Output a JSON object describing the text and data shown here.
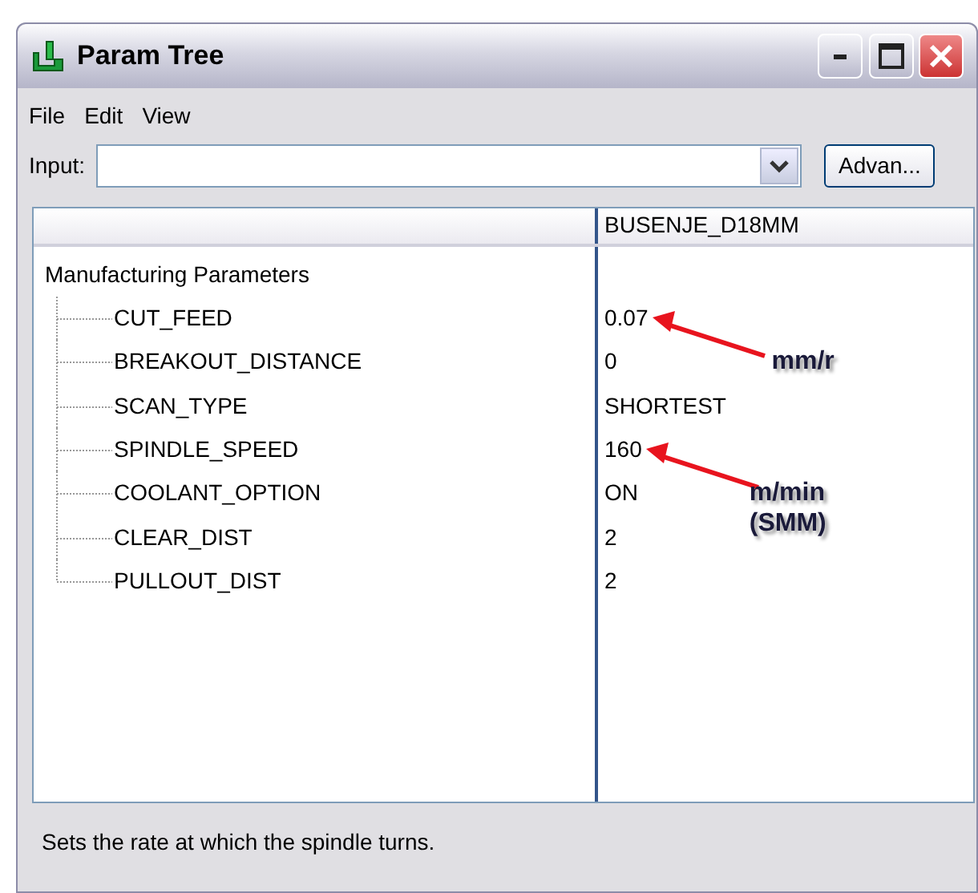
{
  "window": {
    "title": "Param Tree"
  },
  "menu": [
    "File",
    "Edit",
    "View"
  ],
  "input": {
    "label": "Input:"
  },
  "advanced_button": "Advan...",
  "tree": {
    "columns": [
      "BUSENJE_D18MM"
    ],
    "root": {
      "label": "Manufacturing Parameters",
      "children": [
        {
          "label": "CUT_FEED",
          "value": "0.07",
          "annotation": {
            "lines": [
              "mm/r"
            ]
          }
        },
        {
          "label": "BREAKOUT_DISTANCE",
          "value": "0"
        },
        {
          "label": "SCAN_TYPE",
          "value": "SHORTEST"
        },
        {
          "label": "SPINDLE_SPEED",
          "value": "160",
          "annotation": {
            "lines": [
              "m/min",
              "(SMM)"
            ]
          }
        },
        {
          "label": "COOLANT_OPTION",
          "value": "ON"
        },
        {
          "label": "CLEAR_DIST",
          "value": "2"
        },
        {
          "label": "PULLOUT_DIST",
          "value": "2"
        }
      ]
    }
  },
  "status_bar": "Sets the rate at which the spindle turns."
}
